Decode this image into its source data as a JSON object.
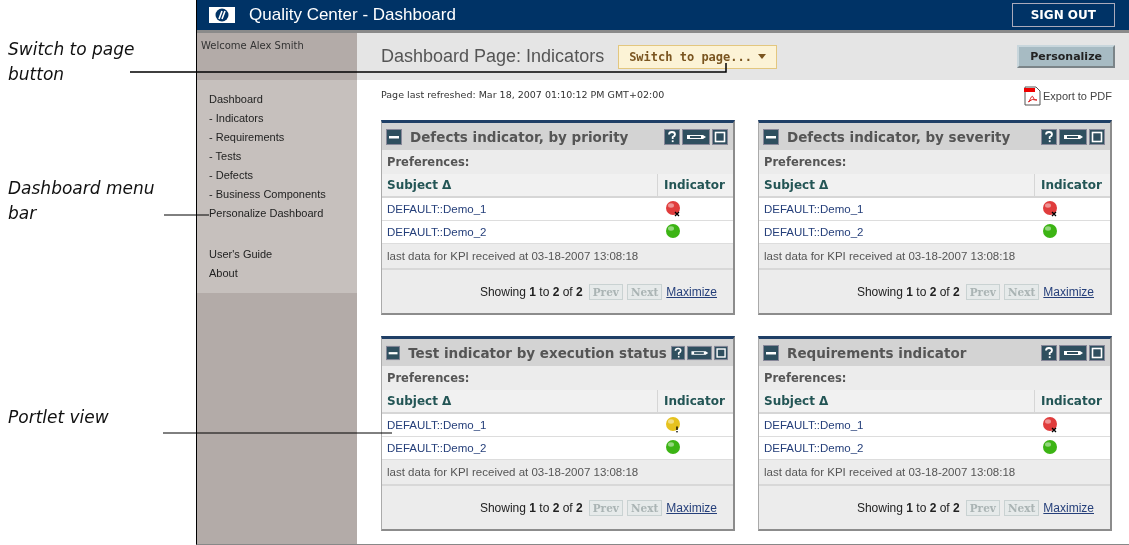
{
  "callouts": [
    {
      "text": "Switch to page button"
    },
    {
      "text": "Dashboard menu bar"
    },
    {
      "text": "Portlet view"
    }
  ],
  "window": {
    "title": "Quality Center - Dashboard",
    "sign_out": "SIGN OUT"
  },
  "sidebar": {
    "welcome": "Welcome Alex Smith",
    "menu_items": [
      "Dashboard",
      "- Indicators",
      "- Requirements",
      "- Tests",
      "- Defects",
      "- Business Components",
      "Personalize Dashboard"
    ],
    "help_links": [
      "User's Guide",
      "About"
    ]
  },
  "page": {
    "title": "Dashboard Page: Indicators",
    "switch_button": "Switch to page...",
    "personalize_button": "Personalize",
    "refreshed": "Page last refreshed: Mar 18, 2007 01:10:12 PM GMT+02:00",
    "export_link": "Export to PDF"
  },
  "portlets": [
    {
      "title": "Defects indicator, by priority",
      "preferences": "Preferences:",
      "columns": [
        "Subject Δ",
        "Indicator"
      ],
      "rows": [
        {
          "subject": "DEFAULT::Demo_1",
          "color": "#e03c3c",
          "failed": true,
          "warning": false
        },
        {
          "subject": "DEFAULT::Demo_2",
          "color": "#3cb414",
          "failed": false,
          "warning": false
        }
      ],
      "footer": "last data for KPI received at 03-18-2007 13:08:18",
      "showing": "Showing **1** to **2** of **2**",
      "prev": {
        "label": "Prev",
        "disabled": true
      },
      "next": {
        "label": "Next",
        "disabled": true
      },
      "maximize": "Maximize"
    },
    {
      "title": "Defects indicator, by severity",
      "preferences": "Preferences:",
      "columns": [
        "Subject Δ",
        "Indicator"
      ],
      "rows": [
        {
          "subject": "DEFAULT::Demo_1",
          "color": "#e03c3c",
          "failed": true,
          "warning": false
        },
        {
          "subject": "DEFAULT::Demo_2",
          "color": "#3cb414",
          "failed": false,
          "warning": false
        }
      ],
      "footer": "last data for KPI received at 03-18-2007 13:08:18",
      "showing": "Showing **1** to **2** of **2**",
      "prev": {
        "label": "Prev",
        "disabled": true
      },
      "next": {
        "label": "Next",
        "disabled": true
      },
      "maximize": "Maximize"
    },
    {
      "title": "Test indicator by execution status",
      "preferences": "Preferences:",
      "columns": [
        "Subject Δ",
        "Indicator"
      ],
      "rows": [
        {
          "subject": "DEFAULT::Demo_1",
          "color": "#e6c21e",
          "failed": false,
          "warning": true
        },
        {
          "subject": "DEFAULT::Demo_2",
          "color": "#3cb414",
          "failed": false,
          "warning": false
        }
      ],
      "footer": "last data for KPI received at 03-18-2007 13:08:18",
      "showing": "Showing **1** to **2** of **2**",
      "prev": {
        "label": "Prev",
        "disabled": true
      },
      "next": {
        "label": "Next",
        "disabled": true
      },
      "maximize": "Maximize"
    },
    {
      "title": "Requirements indicator",
      "preferences": "Preferences:",
      "columns": [
        "Subject Δ",
        "Indicator"
      ],
      "rows": [
        {
          "subject": "DEFAULT::Demo_1",
          "color": "#e03c3c",
          "failed": true,
          "warning": false
        },
        {
          "subject": "DEFAULT::Demo_2",
          "color": "#3cb414",
          "failed": false,
          "warning": false
        }
      ],
      "footer": "last data for KPI received at 03-18-2007 13:08:18",
      "showing": "Showing **1** to **2** of **2**",
      "prev": {
        "label": "Prev",
        "disabled": true
      },
      "next": {
        "label": "Next",
        "disabled": true
      },
      "maximize": "Maximize"
    }
  ]
}
